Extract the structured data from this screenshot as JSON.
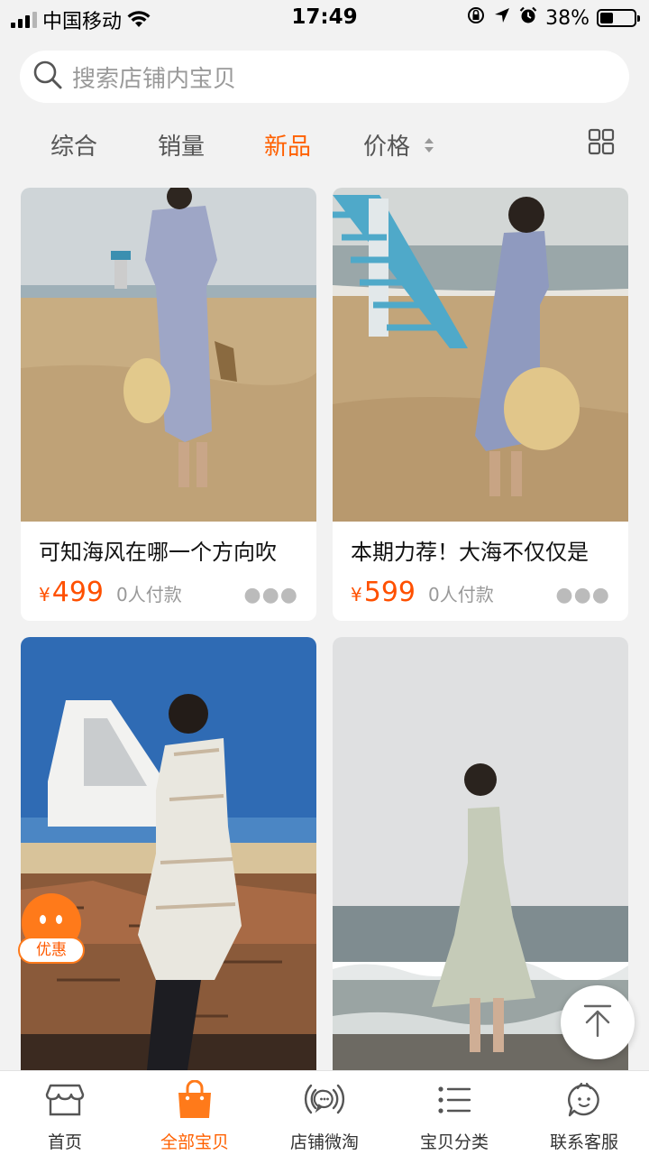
{
  "status_bar": {
    "carrier": "中国移动",
    "time": "17:49",
    "battery_percent": "38%",
    "battery_level": 0.38
  },
  "search": {
    "placeholder": "搜索店铺内宝贝"
  },
  "sort_tabs": [
    {
      "label": "综合",
      "active": false
    },
    {
      "label": "销量",
      "active": false
    },
    {
      "label": "新品",
      "active": true
    },
    {
      "label": "价格",
      "active": false
    }
  ],
  "products": [
    {
      "title": "可知海风在哪一个方向吹",
      "currency": "¥",
      "price": "499",
      "paid": "0人付款"
    },
    {
      "title": "本期力荐！大海不仅仅是",
      "currency": "¥",
      "price": "599",
      "paid": "0人付款"
    },
    {
      "title": "",
      "currency": "",
      "price": "",
      "paid": ""
    },
    {
      "title": "",
      "currency": "",
      "price": "",
      "paid": ""
    }
  ],
  "coupon_badge": {
    "label": "优惠"
  },
  "bottom_nav": [
    {
      "label": "首页",
      "icon": "storefront-icon",
      "active": false
    },
    {
      "label": "全部宝贝",
      "icon": "shopping-bag-icon",
      "active": true
    },
    {
      "label": "店铺微淘",
      "icon": "broadcast-chat-icon",
      "active": false
    },
    {
      "label": "宝贝分类",
      "icon": "list-icon",
      "active": false
    },
    {
      "label": "联系客服",
      "icon": "service-chat-icon",
      "active": false
    }
  ],
  "colors": {
    "accent": "#ff6000",
    "price": "#ff5000",
    "background": "#f2f2f2"
  }
}
